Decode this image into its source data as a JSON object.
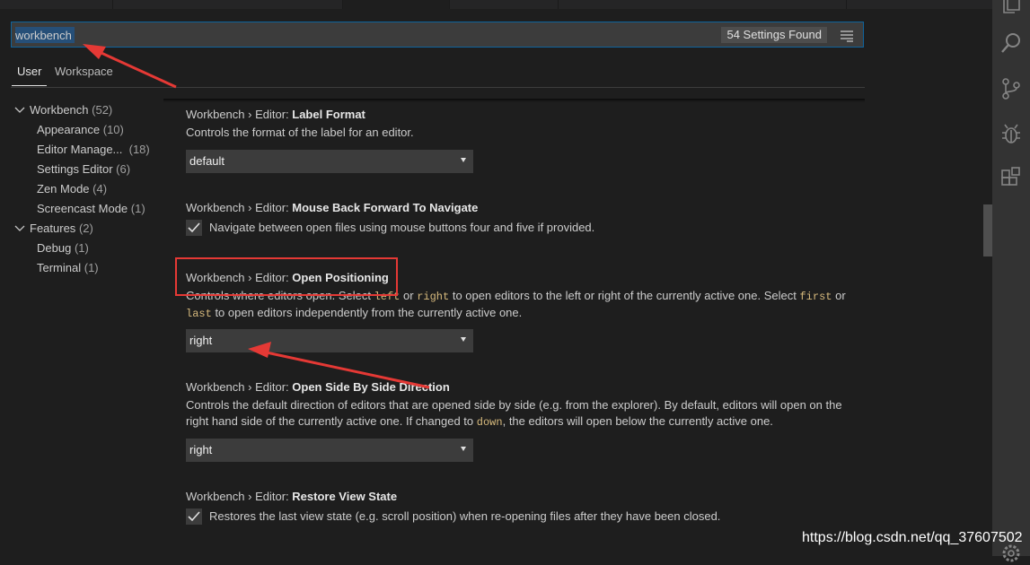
{
  "search": {
    "value": "workbench",
    "results_label": "54 Settings Found"
  },
  "scope_tabs": [
    {
      "label": "User",
      "active": true
    },
    {
      "label": "Workspace",
      "active": false
    }
  ],
  "toc": {
    "items": [
      {
        "label": "Workbench",
        "count": "(52)",
        "expanded": true,
        "level": 0
      },
      {
        "label": "Appearance",
        "count": "(10)",
        "level": 1
      },
      {
        "label": "Editor Manage...",
        "count": "(18)",
        "level": 1
      },
      {
        "label": "Settings Editor",
        "count": "(6)",
        "level": 1
      },
      {
        "label": "Zen Mode",
        "count": "(4)",
        "level": 1
      },
      {
        "label": "Screencast Mode",
        "count": "(1)",
        "level": 1
      },
      {
        "label": "Features",
        "count": "(2)",
        "expanded": true,
        "level": 0
      },
      {
        "label": "Debug",
        "count": "(1)",
        "level": 1
      },
      {
        "label": "Terminal",
        "count": "(1)",
        "level": 1
      }
    ]
  },
  "settings": {
    "label_format": {
      "category": "Workbench › Editor:",
      "name": "Label Format",
      "description": "Controls the format of the label for an editor.",
      "value": "default"
    },
    "mouse_nav": {
      "category": "Workbench › Editor:",
      "name": "Mouse Back Forward To Navigate",
      "description": "Navigate between open files using mouse buttons four and five if provided.",
      "checked": true
    },
    "open_positioning": {
      "category": "Workbench › Editor:",
      "name": "Open Positioning",
      "desc_1": "Controls where editors open. Select",
      "code_left": "left",
      "desc_2": "or",
      "code_right": "right",
      "desc_3": "to open editors to the left or right of the currently active one. Select",
      "code_first": "first",
      "desc_4": "or",
      "code_last": "last",
      "desc_5": "to open editors independently from the currently active one.",
      "value": "right"
    },
    "side_by_side": {
      "category": "Workbench › Editor:",
      "name": "Open Side By Side Direction",
      "desc_1": "Controls the default direction of editors that are opened side by side (e.g. from the explorer). By default, editors will open on the right hand side of the currently active one. If changed to",
      "code_down": "down",
      "desc_2": ", the editors will open below the currently active one.",
      "value": "right"
    },
    "restore_view": {
      "category": "Workbench › Editor:",
      "name": "Restore View State",
      "description": "Restores the last view state (e.g. scroll position) when re-opening files after they have been closed.",
      "checked": true
    }
  },
  "activity_bar": [
    "files-icon",
    "search-icon",
    "source-control-icon",
    "debug-icon",
    "extensions-icon",
    "gear-icon"
  ],
  "watermark": "https://blog.csdn.net/qq_37607502",
  "colors": {
    "background": "#1e1e1e",
    "accent": "#0e639c",
    "annotation": "#e53935"
  }
}
